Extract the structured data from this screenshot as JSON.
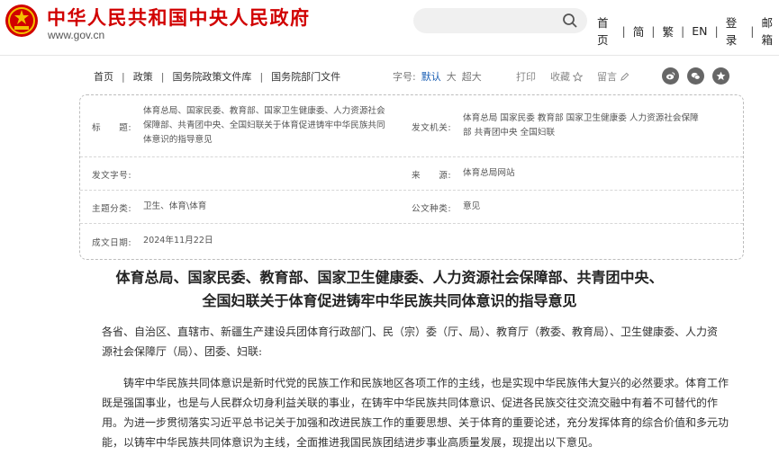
{
  "site": {
    "title": "中华人民共和国中央人民政府",
    "url": "www.gov.cn",
    "emblem_icon": "national-emblem-icon"
  },
  "search": {
    "placeholder": ""
  },
  "topnav": [
    "首页",
    "简",
    "繁",
    "EN",
    "登录",
    "邮箱"
  ],
  "breadcrumb": [
    "首页",
    "政策",
    "国务院政策文件库",
    "国务院部门文件"
  ],
  "font_size": {
    "label": "字号:",
    "options": [
      "默认",
      "大",
      "超大"
    ],
    "selected": "默认"
  },
  "tools": {
    "print": "打印",
    "favorite": "收藏",
    "comment": "留言"
  },
  "share_icons": [
    "weibo-icon",
    "wechat-icon",
    "qzone-icon"
  ],
  "info": {
    "title_label": "标　　题:",
    "title_value": [
      "体育总局、国家民委、教育部、国家卫生健康委、人力资源社会",
      "保障部、共青团中央、全国妇联关于体育促进铸牢中华民族共同",
      "体意识的指导意见"
    ],
    "issuer_label": "发文机关:",
    "issuer_value": [
      "体育总局 国家民委 教育部 国家卫生健康委 人力资源社会保障",
      "部 共青团中央 全国妇联"
    ],
    "doc_no_label": "发文字号:",
    "doc_no_value": "",
    "source_label": "来　　源:",
    "source_value": "体育总局网站",
    "topic_label": "主题分类:",
    "topic_value": "卫生、体育\\体育",
    "genre_label": "公文种类:",
    "genre_value": "意见",
    "date_label": "成文日期:",
    "date_value": "2024年11月22日"
  },
  "article": {
    "title_line1": "体育总局、国家民委、教育部、国家卫生健康委、人力资源社会保障部、共青团中央、",
    "title_line2": "全国妇联关于体育促进铸牢中华民族共同体意识的指导意见",
    "salutation_line1": "各省、自治区、直辖市、新疆生产建设兵团体育行政部门、民（宗）委（厅、局）、教育厅（教委、教育局）、卫生健康委、人力资",
    "salutation_line2": "源社会保障厅（局）、团委、妇联:",
    "body_line1": "铸牢中华民族共同体意识是新时代党的民族工作和民族地区各项工作的主线，也是实现中华民族伟大复兴的必然要求。体育工作",
    "body_line2": "既是强国事业，也是与人民群众切身利益关联的事业，在铸牢中华民族共同体意识、促进各民族交往交流交融中有着不可替代的作",
    "body_line3": "用。为进一步贯彻落实习近平总书记关于加强和改进民族工作的重要思想、关于体育的重要论述，充分发挥体育的综合价值和多元功",
    "body_line4": "能，以铸牢中华民族共同体意识为主线，全面推进我国民族团结进步事业高质量发展，现提出以下意见。"
  },
  "colors": {
    "brand_red": "#d10000",
    "link_blue": "#1a5fb4"
  }
}
